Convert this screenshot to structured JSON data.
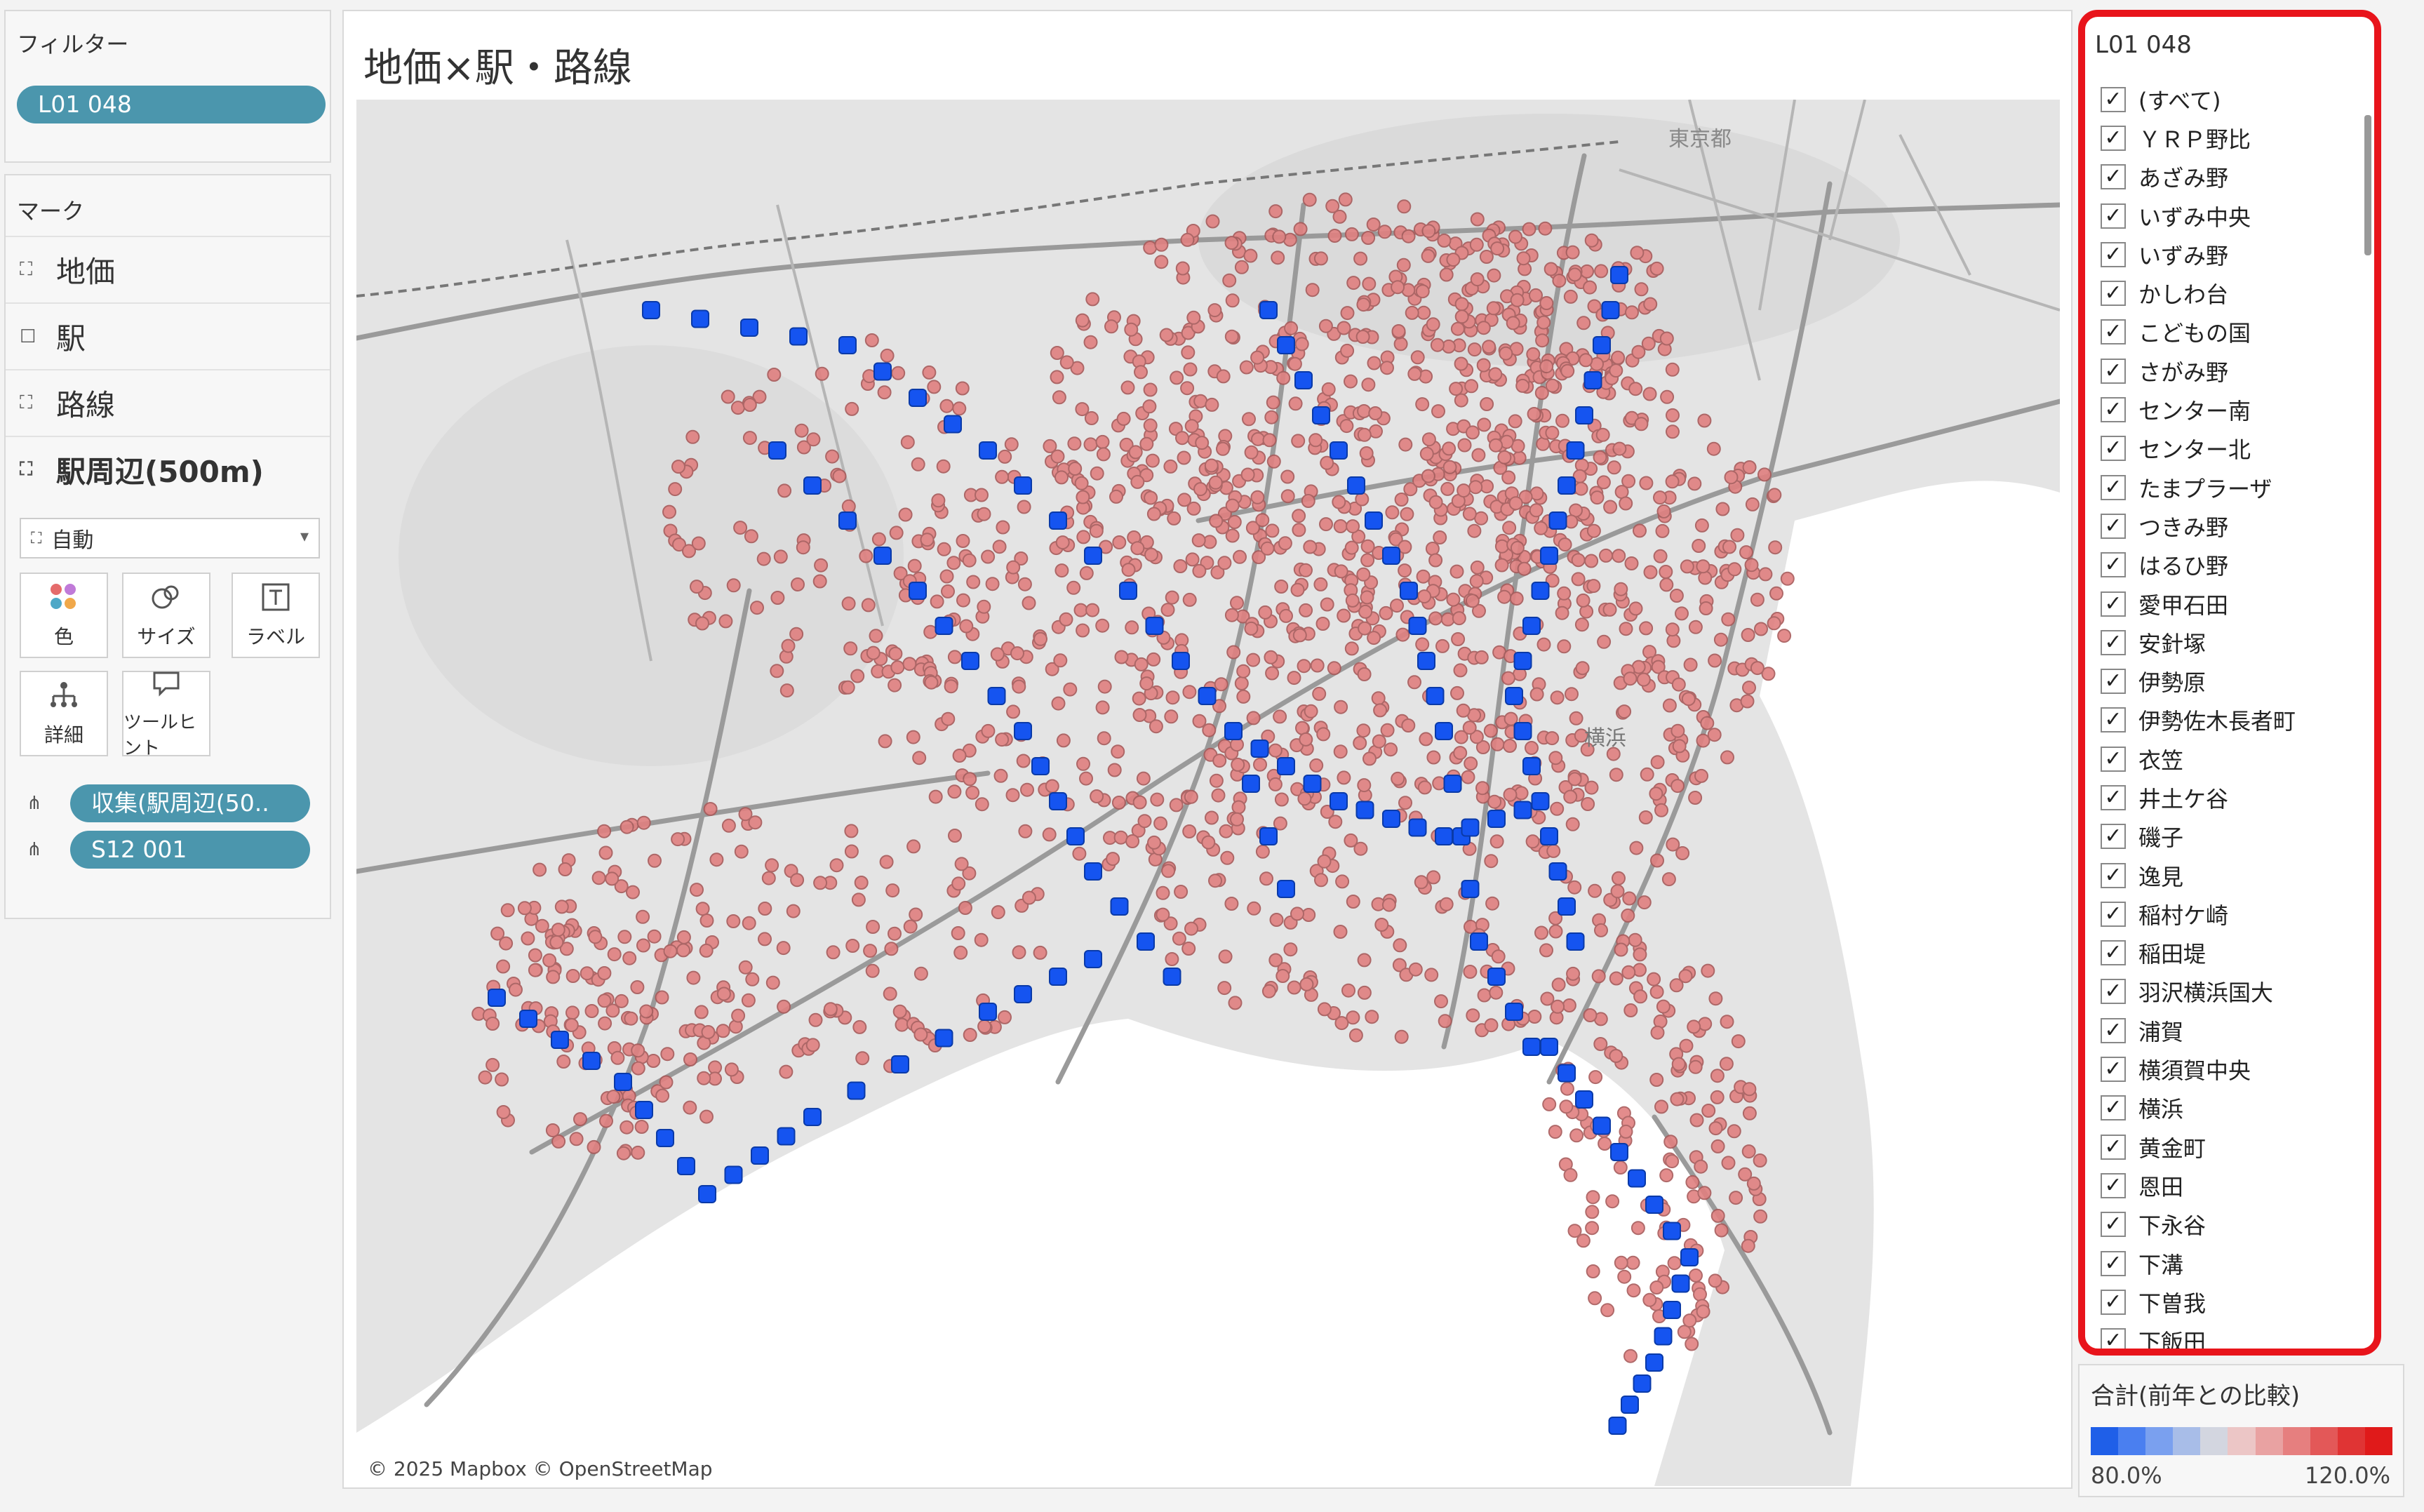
{
  "filters": {
    "title": "フィルター",
    "pill": "L01 048"
  },
  "marks": {
    "title": "マーク",
    "layers": [
      {
        "label": "地価",
        "icon": "map-layer-icon"
      },
      {
        "label": "駅",
        "icon": "square-icon"
      },
      {
        "label": "路線",
        "icon": "map-layer-icon"
      },
      {
        "label": "駅周辺(500m)",
        "icon": "map-layer-icon"
      }
    ],
    "mark_type": "自動",
    "cards": {
      "color": "色",
      "size": "サイズ",
      "label": "ラベル",
      "detail": "詳細",
      "tooltip": "ツールヒント"
    },
    "detail_pills": [
      "収集(駅周辺(50..",
      "S12 001"
    ]
  },
  "worksheet": {
    "title": "地価×駅・路線",
    "map_labels": {
      "tokyo": "東京都",
      "yokohama": "横浜"
    },
    "attribution": "© 2025 Mapbox © OpenStreetMap"
  },
  "filter_panel": {
    "title": "L01 048",
    "items": [
      "(すべて)",
      "ＹＲＰ野比",
      "あざみ野",
      "いずみ中央",
      "いずみ野",
      "かしわ台",
      "こどもの国",
      "さがみ野",
      "センター南",
      "センター北",
      "たまプラーザ",
      "つきみ野",
      "はるひ野",
      "愛甲石田",
      "安針塚",
      "伊勢原",
      "伊勢佐木長者町",
      "衣笠",
      "井土ケ谷",
      "磯子",
      "逸見",
      "稲村ケ崎",
      "稲田堤",
      "羽沢横浜国大",
      "浦賀",
      "横須賀中央",
      "横浜",
      "黄金町",
      "恩田",
      "下永谷",
      "下溝",
      "下曽我",
      "下飯田"
    ],
    "checked_mark": "✓"
  },
  "legend": {
    "title": "合計(前年との比較)",
    "min_label": "80.0%",
    "max_label": "120.0%",
    "colors": [
      "#1f5fe8",
      "#4a7ff0",
      "#7aa0ef",
      "#a8bde8",
      "#d3d6e0",
      "#ecc6c6",
      "#e9a2a2",
      "#e67f7f",
      "#e35858",
      "#e03434",
      "#e01a1a"
    ]
  },
  "colors": {
    "pill": "#4b96ad",
    "highlight_border": "#e8141b",
    "station_blue": "#1554f0",
    "land_price_red": "#e06464"
  }
}
